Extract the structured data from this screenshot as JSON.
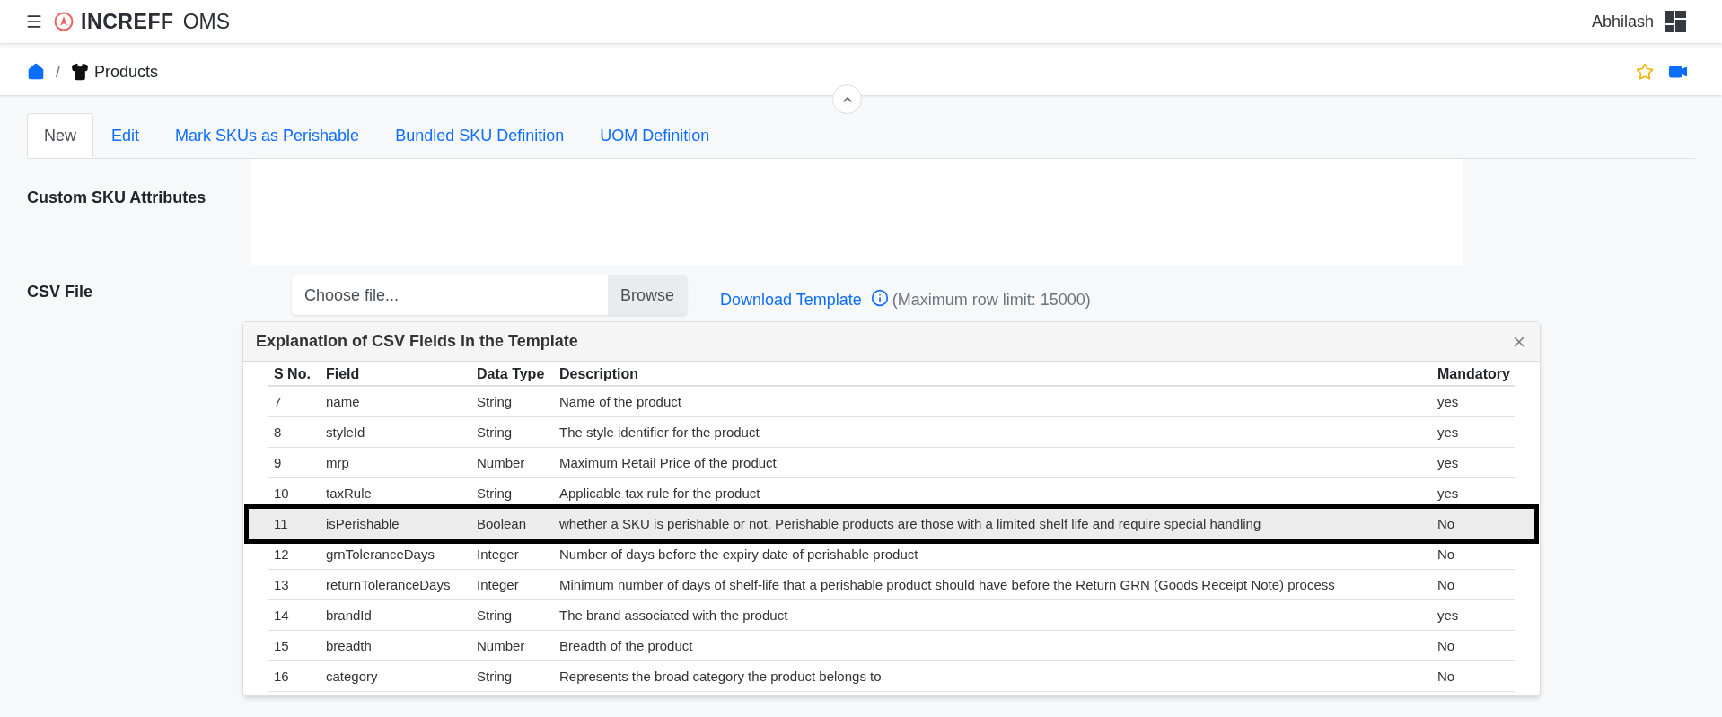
{
  "app": {
    "logo_text": "INCREFF",
    "product": "OMS",
    "user": "Abhilash"
  },
  "breadcrumb": [
    "Products"
  ],
  "breadcrumb_separator": "/",
  "tabs": [
    {
      "label": "New",
      "selected": true
    },
    {
      "label": "Edit",
      "selected": false
    },
    {
      "label": "Mark SKUs as Perishable",
      "selected": false
    },
    {
      "label": "Bundled SKU Definition",
      "selected": false
    },
    {
      "label": "UOM Definition",
      "selected": false
    }
  ],
  "form": {
    "custom_label": "Custom SKU Attributes",
    "csv_label": "CSV File",
    "file_placeholder": "Choose file...",
    "browse": "Browse",
    "download": "Download Template",
    "limit": "(Maximum row limit: 15000)"
  },
  "popup": {
    "title": "Explanation of CSV Fields in the Template",
    "columns": [
      "S No.",
      "Field",
      "Data Type",
      "Description",
      "Mandatory"
    ],
    "rows": [
      {
        "cells": [
          "7",
          "name",
          "String",
          "Name of the product",
          "yes"
        ],
        "selected": false
      },
      {
        "cells": [
          "8",
          "styleId",
          "String",
          "The style identifier for the product",
          "yes"
        ],
        "selected": false
      },
      {
        "cells": [
          "9",
          "mrp",
          "Number",
          "Maximum Retail Price of the product",
          "yes"
        ],
        "selected": false
      },
      {
        "cells": [
          "10",
          "taxRule",
          "String",
          "Applicable tax rule for the product",
          "yes"
        ],
        "selected": false
      },
      {
        "cells": [
          "11",
          "isPerishable",
          "Boolean",
          "whether a SKU is perishable or not. Perishable products are those with a limited shelf life and require special handling",
          "No"
        ],
        "selected": true
      },
      {
        "cells": [
          "12",
          "grnToleranceDays",
          "Integer",
          "Number of days before the expiry date of perishable product",
          "No"
        ],
        "selected": false
      },
      {
        "cells": [
          "13",
          "returnToleranceDays",
          "Integer",
          "Minimum number of days of shelf-life that a perishable product should have before the Return GRN (Goods Receipt Note) process",
          "No"
        ],
        "selected": false
      },
      {
        "cells": [
          "14",
          "brandId",
          "String",
          "The brand associated with the product",
          "yes"
        ],
        "selected": false
      },
      {
        "cells": [
          "15",
          "breadth",
          "Number",
          "Breadth of the product",
          "No"
        ],
        "selected": false
      },
      {
        "cells": [
          "16",
          "category",
          "String",
          "Represents the broad category the product belongs to",
          "No"
        ],
        "selected": false
      }
    ]
  }
}
